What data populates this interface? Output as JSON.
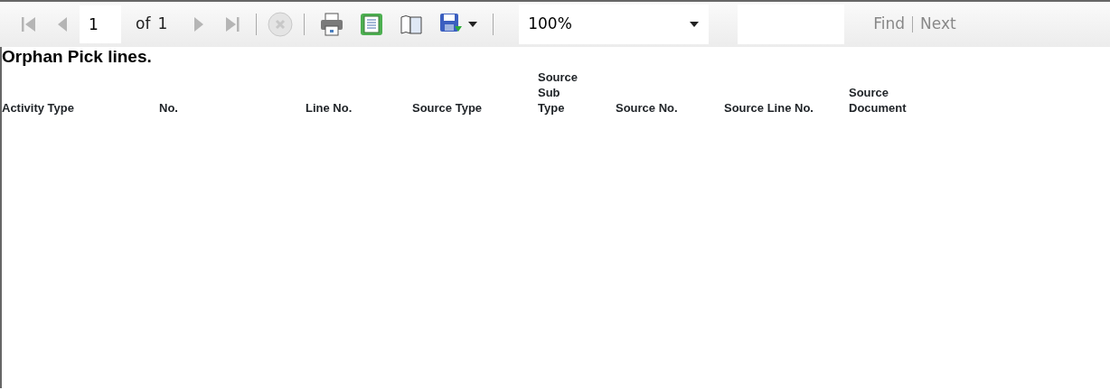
{
  "toolbar": {
    "nav_buttons": [
      {
        "kind": "first",
        "disabled": true
      },
      {
        "kind": "prev",
        "disabled": true
      }
    ],
    "page_field": {
      "value": "1"
    },
    "page_of": "of",
    "page_count": "1",
    "nav_buttons_after": [
      {
        "kind": "next",
        "disabled": true
      },
      {
        "kind": "last",
        "disabled": true
      }
    ],
    "stop_button": {
      "disabled": true
    },
    "tool_buttons": [
      {
        "kind": "print"
      },
      {
        "kind": "page-setup"
      },
      {
        "kind": "layout"
      },
      {
        "kind": "export"
      }
    ],
    "zoom_select": {
      "value": "100%"
    },
    "find_links": [
      {
        "label": "Find",
        "disabled": true
      },
      {
        "label": "Next",
        "disabled": true
      }
    ]
  },
  "report": {
    "title": "Orphan Pick lines.",
    "columns": [
      "Activity Type",
      "No.",
      "Line No.",
      "Source Type",
      "Source Sub Type",
      "Source No.",
      "Source Line No.",
      "Source Document"
    ]
  }
}
